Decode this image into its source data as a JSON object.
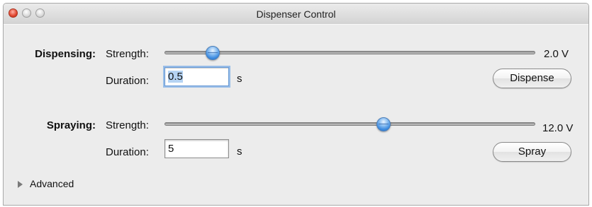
{
  "window": {
    "title": "Dispenser Control"
  },
  "dispensing": {
    "section_label": "Dispensing:",
    "strength_label": "Strength:",
    "strength_value": "2.0 V",
    "strength_level": 0.13,
    "duration_label": "Duration:",
    "duration_value": "0.5",
    "duration_unit": "s",
    "button_label": "Dispense"
  },
  "spraying": {
    "section_label": "Spraying:",
    "strength_label": "Strength:",
    "strength_value": "12.0 V",
    "strength_level": 0.59,
    "duration_label": "Duration:",
    "duration_value": "5",
    "duration_unit": "s",
    "button_label": "Spray"
  },
  "advanced": {
    "label": "Advanced"
  },
  "colors": {
    "slider_knob": "#3c8be0",
    "focus_ring": "#98bde8"
  }
}
